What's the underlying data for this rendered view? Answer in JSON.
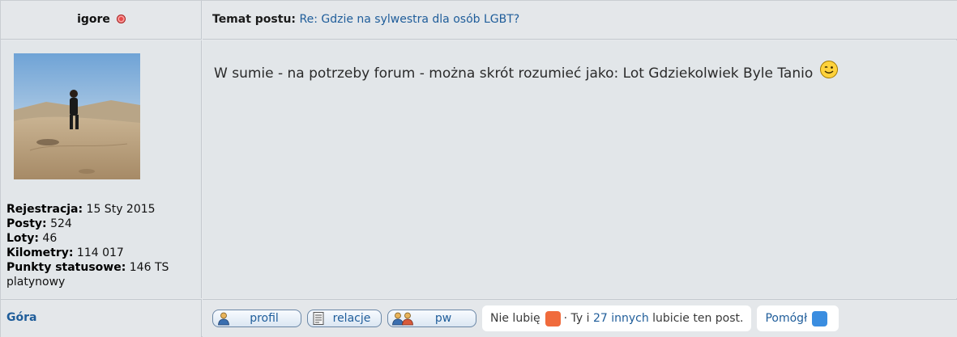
{
  "post": {
    "author": "igore",
    "subject_label": "Temat postu:",
    "subject": "Re: Gdzie na sylwestra dla osób LGBT?",
    "message": "W sumie - na potrzeby forum - można skrót rozumieć jako: Lot Gdziekolwiek Byle Tanio",
    "profile": {
      "registration_label": "Rejestracja:",
      "registration": "15 Sty 2015",
      "posts_label": "Posty:",
      "posts": "524",
      "flights_label": "Loty:",
      "flights": "46",
      "km_label": "Kilometry:",
      "km": "114 017",
      "points_label": "Punkty statusowe:",
      "points": "146 TS",
      "rank": "platynowy"
    },
    "top_link": "Góra",
    "actions": {
      "profil": "profil",
      "relacje": "relacje",
      "pw": "pw",
      "dislike": "Nie lubię",
      "like_prefix": "· Ty i",
      "like_link": "27 innych",
      "like_suffix": "lubicie ten post.",
      "helped": "Pomógł"
    }
  },
  "colors": {
    "link": "#1f5d9a",
    "status_offline": "#e84a4a",
    "dislike_icon": "#f06b3c",
    "helped_icon": "#3a8de0"
  }
}
